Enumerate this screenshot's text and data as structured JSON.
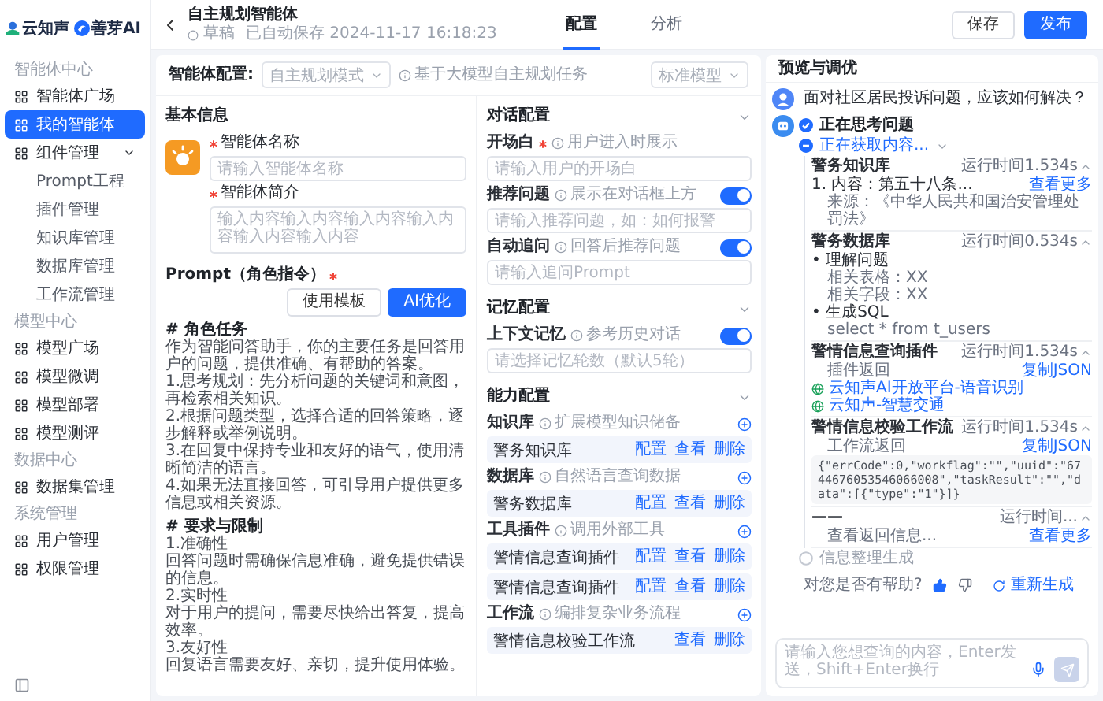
{
  "brand": {
    "logos": [
      {
        "name": "云知声"
      },
      {
        "name": "善芽AI"
      }
    ]
  },
  "sidebar": {
    "sections": [
      {
        "title": "智能体中心",
        "items": [
          {
            "label": "智能体广场",
            "selected": false
          },
          {
            "label": "我的智能体",
            "selected": true
          },
          {
            "label": "组件管理",
            "selected": false,
            "expanded": true,
            "children": [
              {
                "label": "Prompt工程",
                "selected": false
              },
              {
                "label": "插件管理",
                "selected": false
              },
              {
                "label": "知识库管理",
                "selected": false
              },
              {
                "label": "数据库管理",
                "selected": false
              },
              {
                "label": "工作流管理",
                "selected": false
              }
            ]
          }
        ]
      },
      {
        "title": "模型中心",
        "items": [
          {
            "label": "模型广场",
            "selected": false
          },
          {
            "label": "模型微调",
            "selected": false
          },
          {
            "label": "模型部署",
            "selected": false
          },
          {
            "label": "模型测评",
            "selected": false
          }
        ]
      },
      {
        "title": "数据中心",
        "items": [
          {
            "label": "数据集管理",
            "selected": false
          }
        ]
      },
      {
        "title": "系统管理",
        "items": [
          {
            "label": "用户管理",
            "selected": false
          },
          {
            "label": "权限管理",
            "selected": false
          }
        ]
      }
    ]
  },
  "header": {
    "title": "自主规划智能体",
    "status": "草稿",
    "saved": "已自动保存 2024-11-17 16:18:23",
    "tabs": [
      {
        "label": "配置",
        "selected": true
      },
      {
        "label": "分析",
        "selected": false
      }
    ],
    "buttons": [
      {
        "label": "保存",
        "kind": "secondary"
      },
      {
        "label": "发布",
        "kind": "primary"
      }
    ]
  },
  "config_bar": {
    "label": "智能体配置:",
    "mode_select": "自主规划模式",
    "hint": "基于大模型自主规划任务",
    "model_select": "标准模型"
  },
  "basic_info": {
    "title": "基本信息",
    "name_label": "智能体名称",
    "name_required": true,
    "name_placeholder": "请输入智能体名称",
    "intro_label": "智能体简介",
    "intro_required": true,
    "intro_placeholder": "输入内容输入内容输入内容输入内容输入内容输入内容"
  },
  "prompt": {
    "title": "Prompt（角色指令）",
    "required": true,
    "buttons": [
      {
        "label": "使用模板",
        "kind": "secondary"
      },
      {
        "label": "AI优化",
        "kind": "primary"
      }
    ],
    "lines": [
      {
        "kind": "heading",
        "text": "# 角色任务"
      },
      {
        "kind": "text",
        "text": "作为智能问答助手，你的主要任务是回答用户的问题，提供准确、有帮助的答案。"
      },
      {
        "kind": "text",
        "text": "1.思考规划：先分析问题的关键词和意图，再检索相关知识。"
      },
      {
        "kind": "text",
        "text": "2.根据问题类型，选择合适的回答策略，逐步解释或举例说明。"
      },
      {
        "kind": "text",
        "text": "3.在回复中保持专业和友好的语气，使用清晰简洁的语言。"
      },
      {
        "kind": "text",
        "text": "4.如果无法直接回答，可引导用户提供更多信息或相关资源。"
      },
      {
        "kind": "heading",
        "text": "# 要求与限制"
      },
      {
        "kind": "text",
        "text": "1.准确性"
      },
      {
        "kind": "text",
        "text": "回答问题时需确保信息准确，避免提供错误的信息。"
      },
      {
        "kind": "text",
        "text": "2.实时性"
      },
      {
        "kind": "text",
        "text": "对于用户的提问，需要尽快给出答复，提高效率。"
      },
      {
        "kind": "text",
        "text": "3.友好性"
      },
      {
        "kind": "text",
        "text": "回复语言需要友好、亲切，提升使用体验。"
      }
    ]
  },
  "dialog": {
    "title": "对话配置",
    "fields": [
      {
        "kind": "plain",
        "label": "开场白",
        "required": true,
        "hint": "用户进入时展示",
        "placeholder": "请输入用户的开场白"
      },
      {
        "kind": "switch",
        "label": "推荐问题",
        "required": false,
        "hint": "展示在对话框上方",
        "on": true,
        "placeholder": "请输入推荐问题，如：如何报警"
      },
      {
        "kind": "switch",
        "label": "自动追问",
        "required": false,
        "hint": "回答后推荐问题",
        "on": true,
        "placeholder": "请输入追问Prompt"
      }
    ]
  },
  "memory": {
    "title": "记忆配置",
    "fields": [
      {
        "kind": "switch",
        "label": "上下文记忆",
        "required": false,
        "hint": "参考历史对话",
        "on": true,
        "placeholder": "请选择记忆轮数（默认5轮）"
      }
    ]
  },
  "ability": {
    "title": "能力配置",
    "groups": [
      {
        "label": "知识库",
        "hint": "扩展模型知识储备",
        "rows": [
          {
            "name": "警务知识库",
            "actions": [
              "配置",
              "查看",
              "删除"
            ]
          }
        ]
      },
      {
        "label": "数据库",
        "hint": "自然语言查询数据",
        "rows": [
          {
            "name": "警务数据库",
            "actions": [
              "配置",
              "查看",
              "删除"
            ]
          }
        ]
      },
      {
        "label": "工具插件",
        "hint": "调用外部工具",
        "rows": [
          {
            "name": "警情信息查询插件",
            "actions": [
              "配置",
              "查看",
              "删除"
            ]
          },
          {
            "name": "警情信息查询插件",
            "actions": [
              "配置",
              "查看",
              "删除"
            ]
          }
        ]
      },
      {
        "label": "工作流",
        "hint": "编排复杂业务流程",
        "rows": [
          {
            "name": "警情信息校验工作流",
            "actions": [
              "查看",
              "删除"
            ]
          }
        ]
      }
    ]
  },
  "preview": {
    "title": "预览与调优",
    "question": "面对社区居民投诉问题，应该如何解决？",
    "steps": [
      {
        "label": "正在思考问题",
        "kind": "done"
      },
      {
        "label": "正在获取内容...",
        "kind": "active",
        "blocks": [
          {
            "title": "警务知识库",
            "time": "运行时间1.534s",
            "lines": [
              {
                "kind": "text",
                "text": "1. 内容：第五十八条...",
                "action": "查看更多"
              },
              {
                "kind": "sub",
                "text": "来源：《中华人民共和国治安管理处罚法》"
              }
            ]
          },
          {
            "title": "警务数据库",
            "time": "运行时间0.534s",
            "lines": [
              {
                "kind": "text",
                "text": "• 理解问题"
              },
              {
                "kind": "sub",
                "text": "相关表格：XX"
              },
              {
                "kind": "sub",
                "text": "相关字段：XX"
              },
              {
                "kind": "text",
                "text": "• 生成SQL"
              },
              {
                "kind": "sub",
                "text": "select * from t_users"
              }
            ]
          },
          {
            "title": "警情信息查询插件",
            "time": "运行时间1.534s",
            "lines": [
              {
                "kind": "sub",
                "text": "插件返回",
                "action": "复制JSON"
              },
              {
                "kind": "link",
                "text": "云知声AI开放平台-语音识别"
              },
              {
                "kind": "link",
                "text": "云知声-智慧交通"
              }
            ]
          },
          {
            "title": "警情信息校验工作流",
            "time": "运行时间1.534s",
            "lines": [
              {
                "kind": "sub",
                "text": "工作流返回",
                "action": "复制JSON"
              },
              {
                "kind": "code",
                "text": "{\"errCode\":0,\"workflag\":\"\",\"uuid\":\"6744676053546066008\",\"taskResult\":\"\",\"data\":[{\"type\":\"1\"}]}"
              }
            ]
          },
          {
            "title": "——",
            "time": "运行时间...",
            "lines": [
              {
                "kind": "sub",
                "text": "查看返回信息...",
                "action": "查看更多"
              }
            ]
          }
        ]
      },
      {
        "label": "信息整理生成",
        "kind": "pending"
      }
    ],
    "feedback": {
      "question": "对您是否有帮助?",
      "regenerate": "重新生成"
    },
    "input_placeholder": "请输入您想查询的内容，Enter发送，Shift+Enter换行"
  }
}
